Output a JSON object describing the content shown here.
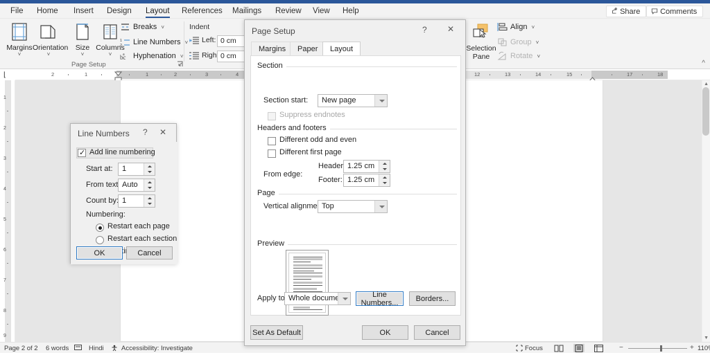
{
  "app": {
    "ribbon_tabs": [
      {
        "label": "File",
        "active": false
      },
      {
        "label": "Home",
        "active": false
      },
      {
        "label": "Insert",
        "active": false
      },
      {
        "label": "Design",
        "active": false
      },
      {
        "label": "Layout",
        "active": true
      },
      {
        "label": "References",
        "active": false
      },
      {
        "label": "Mailings",
        "active": false
      },
      {
        "label": "Review",
        "active": false
      },
      {
        "label": "View",
        "active": false
      },
      {
        "label": "Help",
        "active": false
      }
    ],
    "share_label": "Share",
    "comments_label": "Comments",
    "share_icon": "share-icon",
    "comments_icon": "comment-bubble-icon"
  },
  "ribbon": {
    "page_setup": {
      "group_label": "Page Setup",
      "big_buttons": [
        {
          "label": "Margins",
          "icon": "margins-icon",
          "has_chevron": true
        },
        {
          "label": "Orientation",
          "icon": "orientation-icon",
          "has_chevron": true
        },
        {
          "label": "Size",
          "icon": "size-icon",
          "has_chevron": true
        },
        {
          "label": "Columns",
          "icon": "columns-icon",
          "has_chevron": true
        }
      ],
      "small_buttons": [
        {
          "label": "Breaks",
          "icon": "breaks-icon",
          "has_chevron": true,
          "disabled": false
        },
        {
          "label": "Line Numbers",
          "icon": "line-numbers-icon",
          "has_chevron": true,
          "disabled": false
        },
        {
          "label": "Hyphenation",
          "icon": "hyphenation-icon",
          "has_chevron": true,
          "disabled": false
        }
      ],
      "launcher_icon": "dialog-launcher-icon"
    },
    "paragraph": {
      "group_label": "Indent",
      "rows": [
        {
          "label": "Left:",
          "value": "0 cm",
          "icon": "indent-left-icon"
        },
        {
          "label": "Right:",
          "value": "0 cm",
          "icon": "indent-right-icon"
        }
      ]
    },
    "arrange": {
      "selection_pane_label_line1": "Selection",
      "selection_pane_label_line2": "Pane",
      "selection_pane_icon": "selection-pane-icon",
      "small_buttons": [
        {
          "label": "Align",
          "icon": "align-icon",
          "has_chevron": true,
          "disabled": false
        },
        {
          "label": "Group",
          "icon": "group-icon",
          "has_chevron": true,
          "disabled": true
        },
        {
          "label": "Rotate",
          "icon": "rotate-icon",
          "has_chevron": true,
          "disabled": true
        }
      ]
    },
    "collapse_icon": "collapse-ribbon-icon"
  },
  "ruler": {
    "horizontal_left_ticks": [
      "2",
      "1"
    ],
    "horizontal_right_ticks": [
      "1",
      "2",
      "3",
      "4",
      "12",
      "13",
      "14",
      "15",
      "17",
      "18"
    ],
    "vertical_ticks": [
      "1",
      "2",
      "3",
      "4",
      "5",
      "6",
      "7",
      "8",
      "9"
    ],
    "tab_selector_icon": "tab-stop-left-icon"
  },
  "page_setup_dialog": {
    "title": "Page Setup",
    "help_icon": "help-question-icon",
    "close_icon": "close-icon",
    "tabs": [
      {
        "label": "Margins",
        "active": false
      },
      {
        "label": "Paper",
        "active": false
      },
      {
        "label": "Layout",
        "active": true
      }
    ],
    "section": {
      "group_label": "Section",
      "section_start_label": "Section start:",
      "section_start_value": "New page",
      "suppress_endnotes_label": "Suppress endnotes",
      "suppress_endnotes_checked": false,
      "suppress_endnotes_disabled": true
    },
    "headers_footers": {
      "group_label": "Headers and footers",
      "different_odd_even_label": "Different odd and even",
      "different_odd_even_checked": false,
      "different_first_page_label": "Different first page",
      "different_first_page_checked": false,
      "from_edge_label": "From edge:",
      "header_label": "Header:",
      "header_value": "1.25 cm",
      "footer_label": "Footer:",
      "footer_value": "1.25 cm"
    },
    "page": {
      "group_label": "Page",
      "vertical_alignment_label": "Vertical alignment:",
      "vertical_alignment_value": "Top"
    },
    "preview": {
      "group_label": "Preview"
    },
    "apply_to_label": "Apply to:",
    "apply_to_value": "Whole document",
    "line_numbers_button": "Line Numbers...",
    "borders_button": "Borders...",
    "set_as_default_button": "Set As Default",
    "ok_button": "OK",
    "cancel_button": "Cancel"
  },
  "line_numbers_dialog": {
    "title": "Line Numbers",
    "help_icon": "help-question-icon",
    "close_icon": "close-icon",
    "add_line_numbering_label": "Add line numbering",
    "add_line_numbering_checked": true,
    "fields": [
      {
        "label": "Start at:",
        "value": "1"
      },
      {
        "label": "From text:",
        "value": "Auto"
      },
      {
        "label": "Count by:",
        "value": "1"
      }
    ],
    "numbering_label": "Numbering:",
    "radios": [
      {
        "label": "Restart each page",
        "selected": true
      },
      {
        "label": "Restart each section",
        "selected": false
      },
      {
        "label": "Continuous",
        "selected": false
      }
    ],
    "ok_button": "OK",
    "cancel_button": "Cancel"
  },
  "status_bar": {
    "page_text": "Page 2 of 2",
    "words_text": "6 words",
    "proofing_icon": "proofing-errors-icon",
    "language_text": "Hindi",
    "accessibility_icon": "accessibility-icon",
    "accessibility_text": "Accessibility: Investigate",
    "focus_icon": "focus-mode-icon",
    "focus_text": "Focus",
    "view_read_icon": "read-mode-icon",
    "view_print_icon": "print-layout-icon",
    "view_web_icon": "web-layout-icon",
    "zoom_out_icon": "zoom-out-icon",
    "zoom_in_icon": "zoom-in-icon",
    "zoom_value": "110%"
  },
  "colors": {
    "accent": "#2b579a",
    "focus_border": "#2f7ac4",
    "ribbon_bg": "#f3f3f3",
    "dialog_bg": "#f0f0f0"
  }
}
